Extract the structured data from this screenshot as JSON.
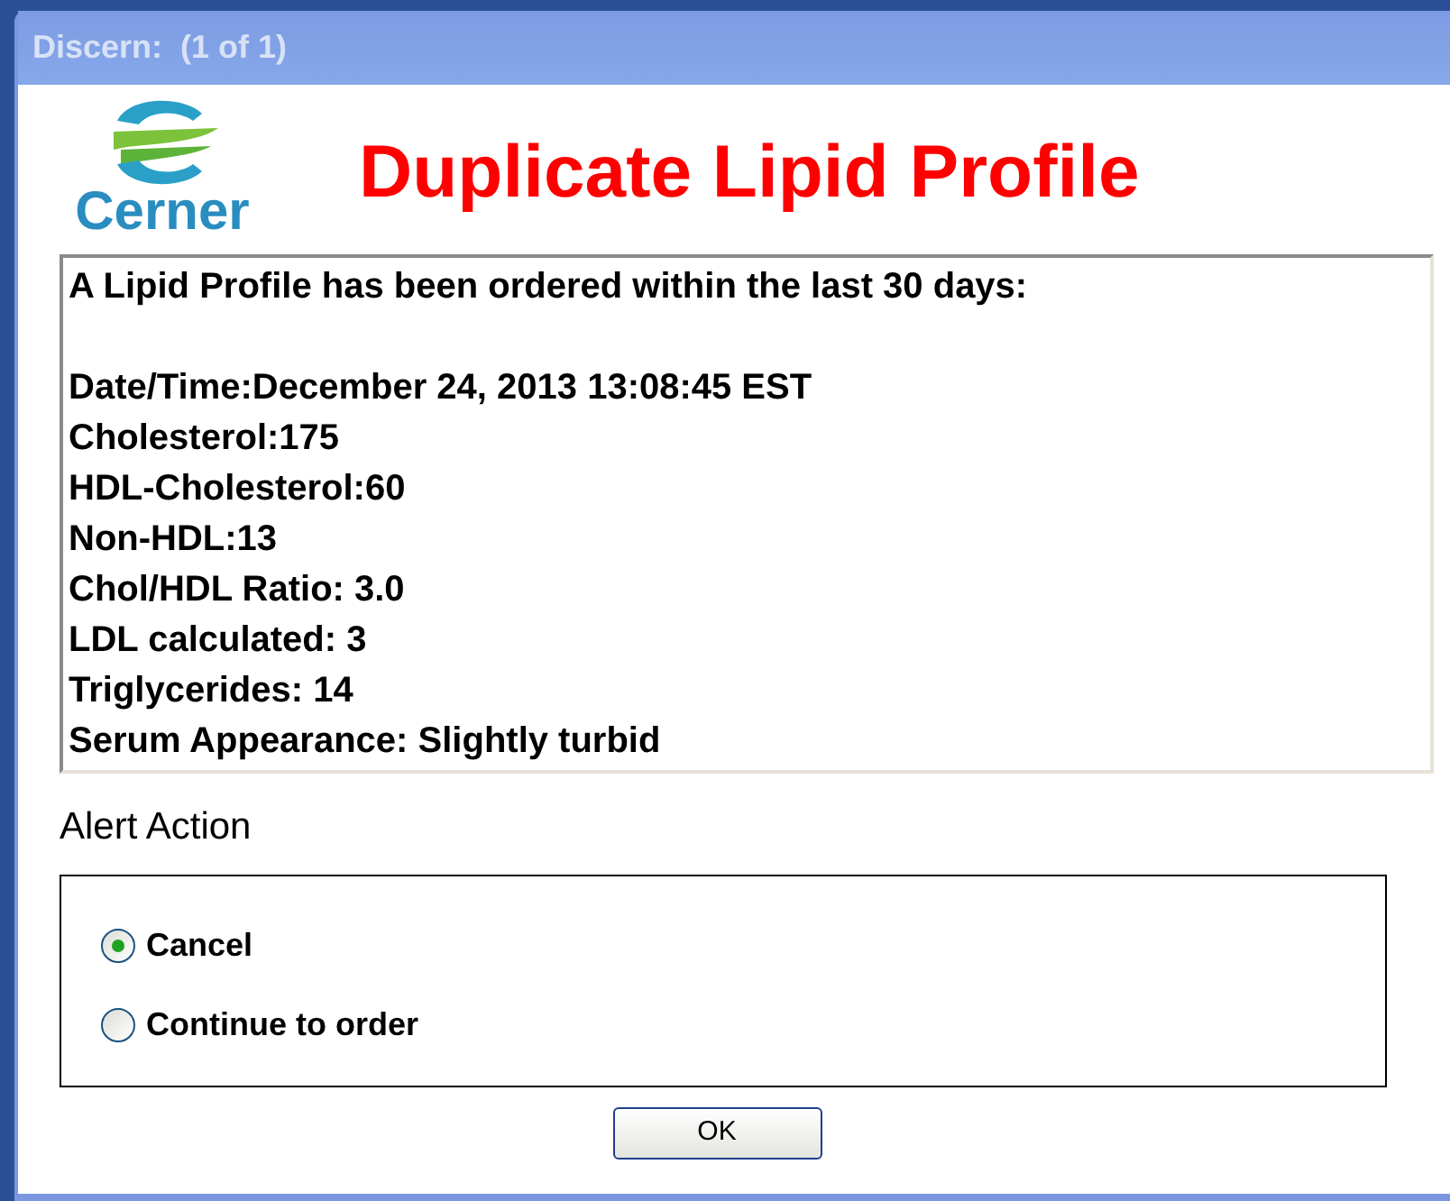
{
  "window": {
    "title": "Discern:  (1 of 1)"
  },
  "logo": {
    "text": "Cerner"
  },
  "heading": "Duplicate Lipid Profile",
  "message": {
    "intro": "A Lipid Profile has been ordered within the last 30 days:",
    "lines": [
      "Date/Time:December 24, 2013 13:08:45 EST",
      "Cholesterol:175",
      "HDL-Cholesterol:60",
      "Non-HDL:13",
      "Chol/HDL Ratio: 3.0",
      "LDL calculated: 3",
      "Triglycerides: 14",
      "Serum Appearance: Slightly turbid"
    ]
  },
  "alert_action": {
    "label": "Alert Action",
    "options": [
      {
        "label": "Cancel",
        "selected": true
      },
      {
        "label": "Continue to order",
        "selected": false
      }
    ]
  },
  "buttons": [
    "OK"
  ]
}
